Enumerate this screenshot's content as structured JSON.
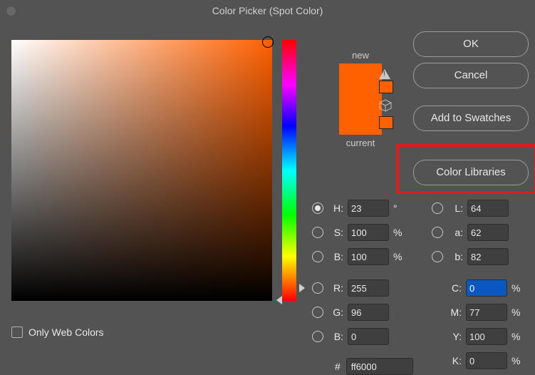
{
  "window": {
    "title": "Color Picker (Spot Color)"
  },
  "buttons": {
    "ok": "OK",
    "cancel": "Cancel",
    "add_to_swatches": "Add to Swatches",
    "color_libraries": "Color Libraries"
  },
  "swatch": {
    "new_label": "new",
    "current_label": "current",
    "new_color": "#ff6000",
    "current_color": "#ff6000",
    "warn_swatch_color": "#ff6000",
    "gamut_swatch_color": "#ff6000"
  },
  "fields": {
    "H": {
      "label": "H:",
      "value": "23",
      "unit": "°",
      "radio": true,
      "selected": true
    },
    "S": {
      "label": "S:",
      "value": "100",
      "unit": "%",
      "radio": true,
      "selected": false
    },
    "B": {
      "label": "B:",
      "value": "100",
      "unit": "%",
      "radio": true,
      "selected": false
    },
    "R": {
      "label": "R:",
      "value": "255",
      "unit": "",
      "radio": true,
      "selected": false
    },
    "G": {
      "label": "G:",
      "value": "96",
      "unit": "",
      "radio": true,
      "selected": false
    },
    "Bc": {
      "label": "B:",
      "value": "0",
      "unit": "",
      "radio": true,
      "selected": false
    },
    "L": {
      "label": "L:",
      "value": "64",
      "unit": "",
      "radio": true,
      "selected": false
    },
    "a": {
      "label": "a:",
      "value": "62",
      "unit": "",
      "radio": true,
      "selected": false
    },
    "b": {
      "label": "b:",
      "value": "82",
      "unit": "",
      "radio": true,
      "selected": false
    },
    "C": {
      "label": "C:",
      "value": "0",
      "unit": "%",
      "radio": false,
      "highlight": true
    },
    "M": {
      "label": "M:",
      "value": "77",
      "unit": "%",
      "radio": false
    },
    "Y": {
      "label": "Y:",
      "value": "100",
      "unit": "%",
      "radio": false
    },
    "K": {
      "label": "K:",
      "value": "0",
      "unit": "%",
      "radio": false
    }
  },
  "hex": {
    "prefix": "#",
    "value": "ff6000"
  },
  "only_web_colors": {
    "label": "Only Web Colors",
    "checked": false
  }
}
